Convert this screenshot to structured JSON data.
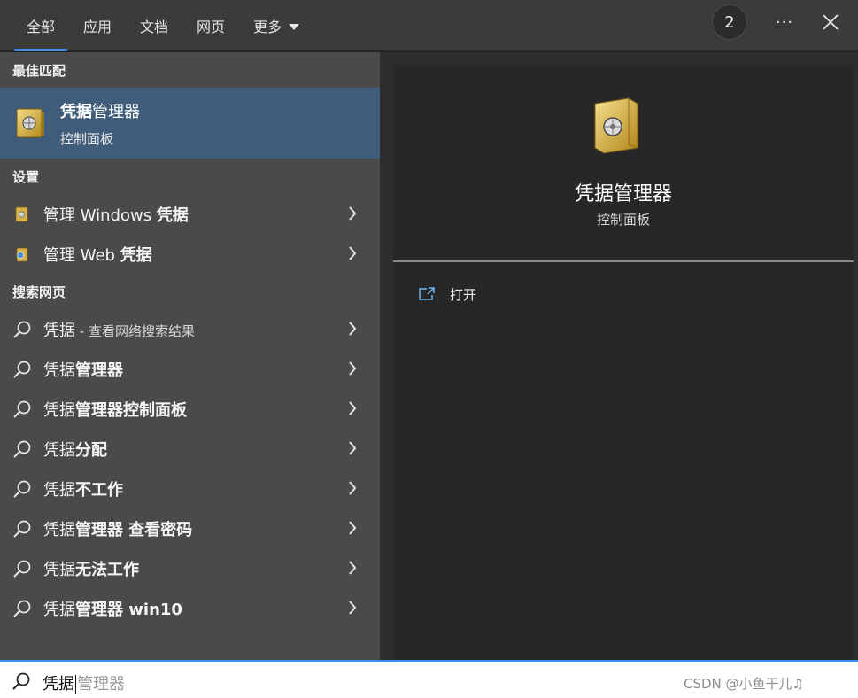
{
  "tabs": [
    {
      "label": "全部",
      "active": true
    },
    {
      "label": "应用",
      "active": false
    },
    {
      "label": "文档",
      "active": false
    },
    {
      "label": "网页",
      "active": false
    },
    {
      "label": "更多",
      "active": false
    }
  ],
  "top_right": {
    "badge_count": "2",
    "more_label": "···"
  },
  "sections": {
    "best_match": "最佳匹配",
    "settings": "设置",
    "search_web": "搜索网页"
  },
  "best_match": {
    "title_bold": "凭据",
    "title_rest": "管理器",
    "subtitle": "控制面板"
  },
  "settings_items": [
    {
      "normal": "管理 Windows ",
      "bold": "凭据"
    },
    {
      "normal": "管理 Web ",
      "bold": "凭据"
    }
  ],
  "web_items": [
    {
      "normal": "凭据",
      "bold": "",
      "sub": " - 查看网络搜索结果"
    },
    {
      "normal": "凭据",
      "bold": "管理器"
    },
    {
      "normal": "凭据",
      "bold": "管理器控制面板"
    },
    {
      "normal": "凭据",
      "bold": "分配"
    },
    {
      "normal": "凭据",
      "bold": "不工作"
    },
    {
      "normal": "凭据",
      "bold": "管理器 查看密码"
    },
    {
      "normal": "凭据",
      "bold": "无法工作"
    },
    {
      "normal": "凭据",
      "bold": "管理器 win10"
    }
  ],
  "preview": {
    "title": "凭据管理器",
    "subtitle": "控制面板",
    "action_label": "打开"
  },
  "search": {
    "typed": "凭据",
    "suggestion": "管理器"
  },
  "watermark": "CSDN @小鱼干儿♫",
  "colors": {
    "accent": "#3b8eea",
    "selected_row": "#3f5d7a",
    "left_pane": "#4a4a4a",
    "preview_pane": "#272727"
  }
}
